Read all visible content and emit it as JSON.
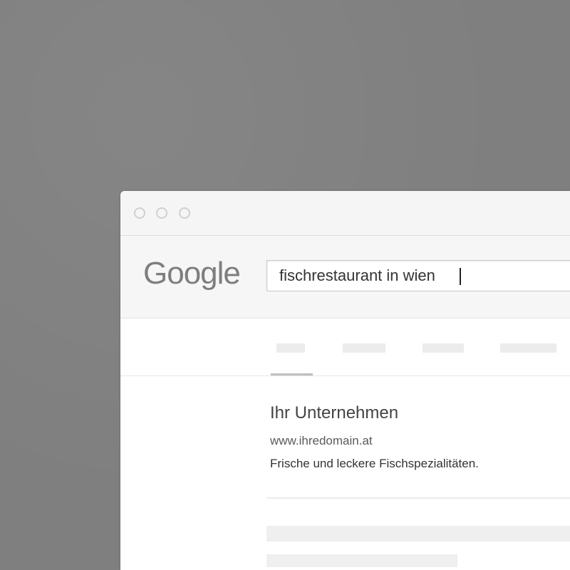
{
  "window": {
    "controls": [
      "close-dot",
      "minimize-dot",
      "maximize-dot"
    ]
  },
  "search": {
    "logo_text": "Google",
    "query": "fischrestaurant in wien",
    "logo_color": "#7e7e7e"
  },
  "tabs": {
    "active_index": 0,
    "count": 4
  },
  "result": {
    "title": "Ihr Unternehmen",
    "url": "www.ihredomain.at",
    "description": "Frische und leckere Fischspezialitäten."
  }
}
